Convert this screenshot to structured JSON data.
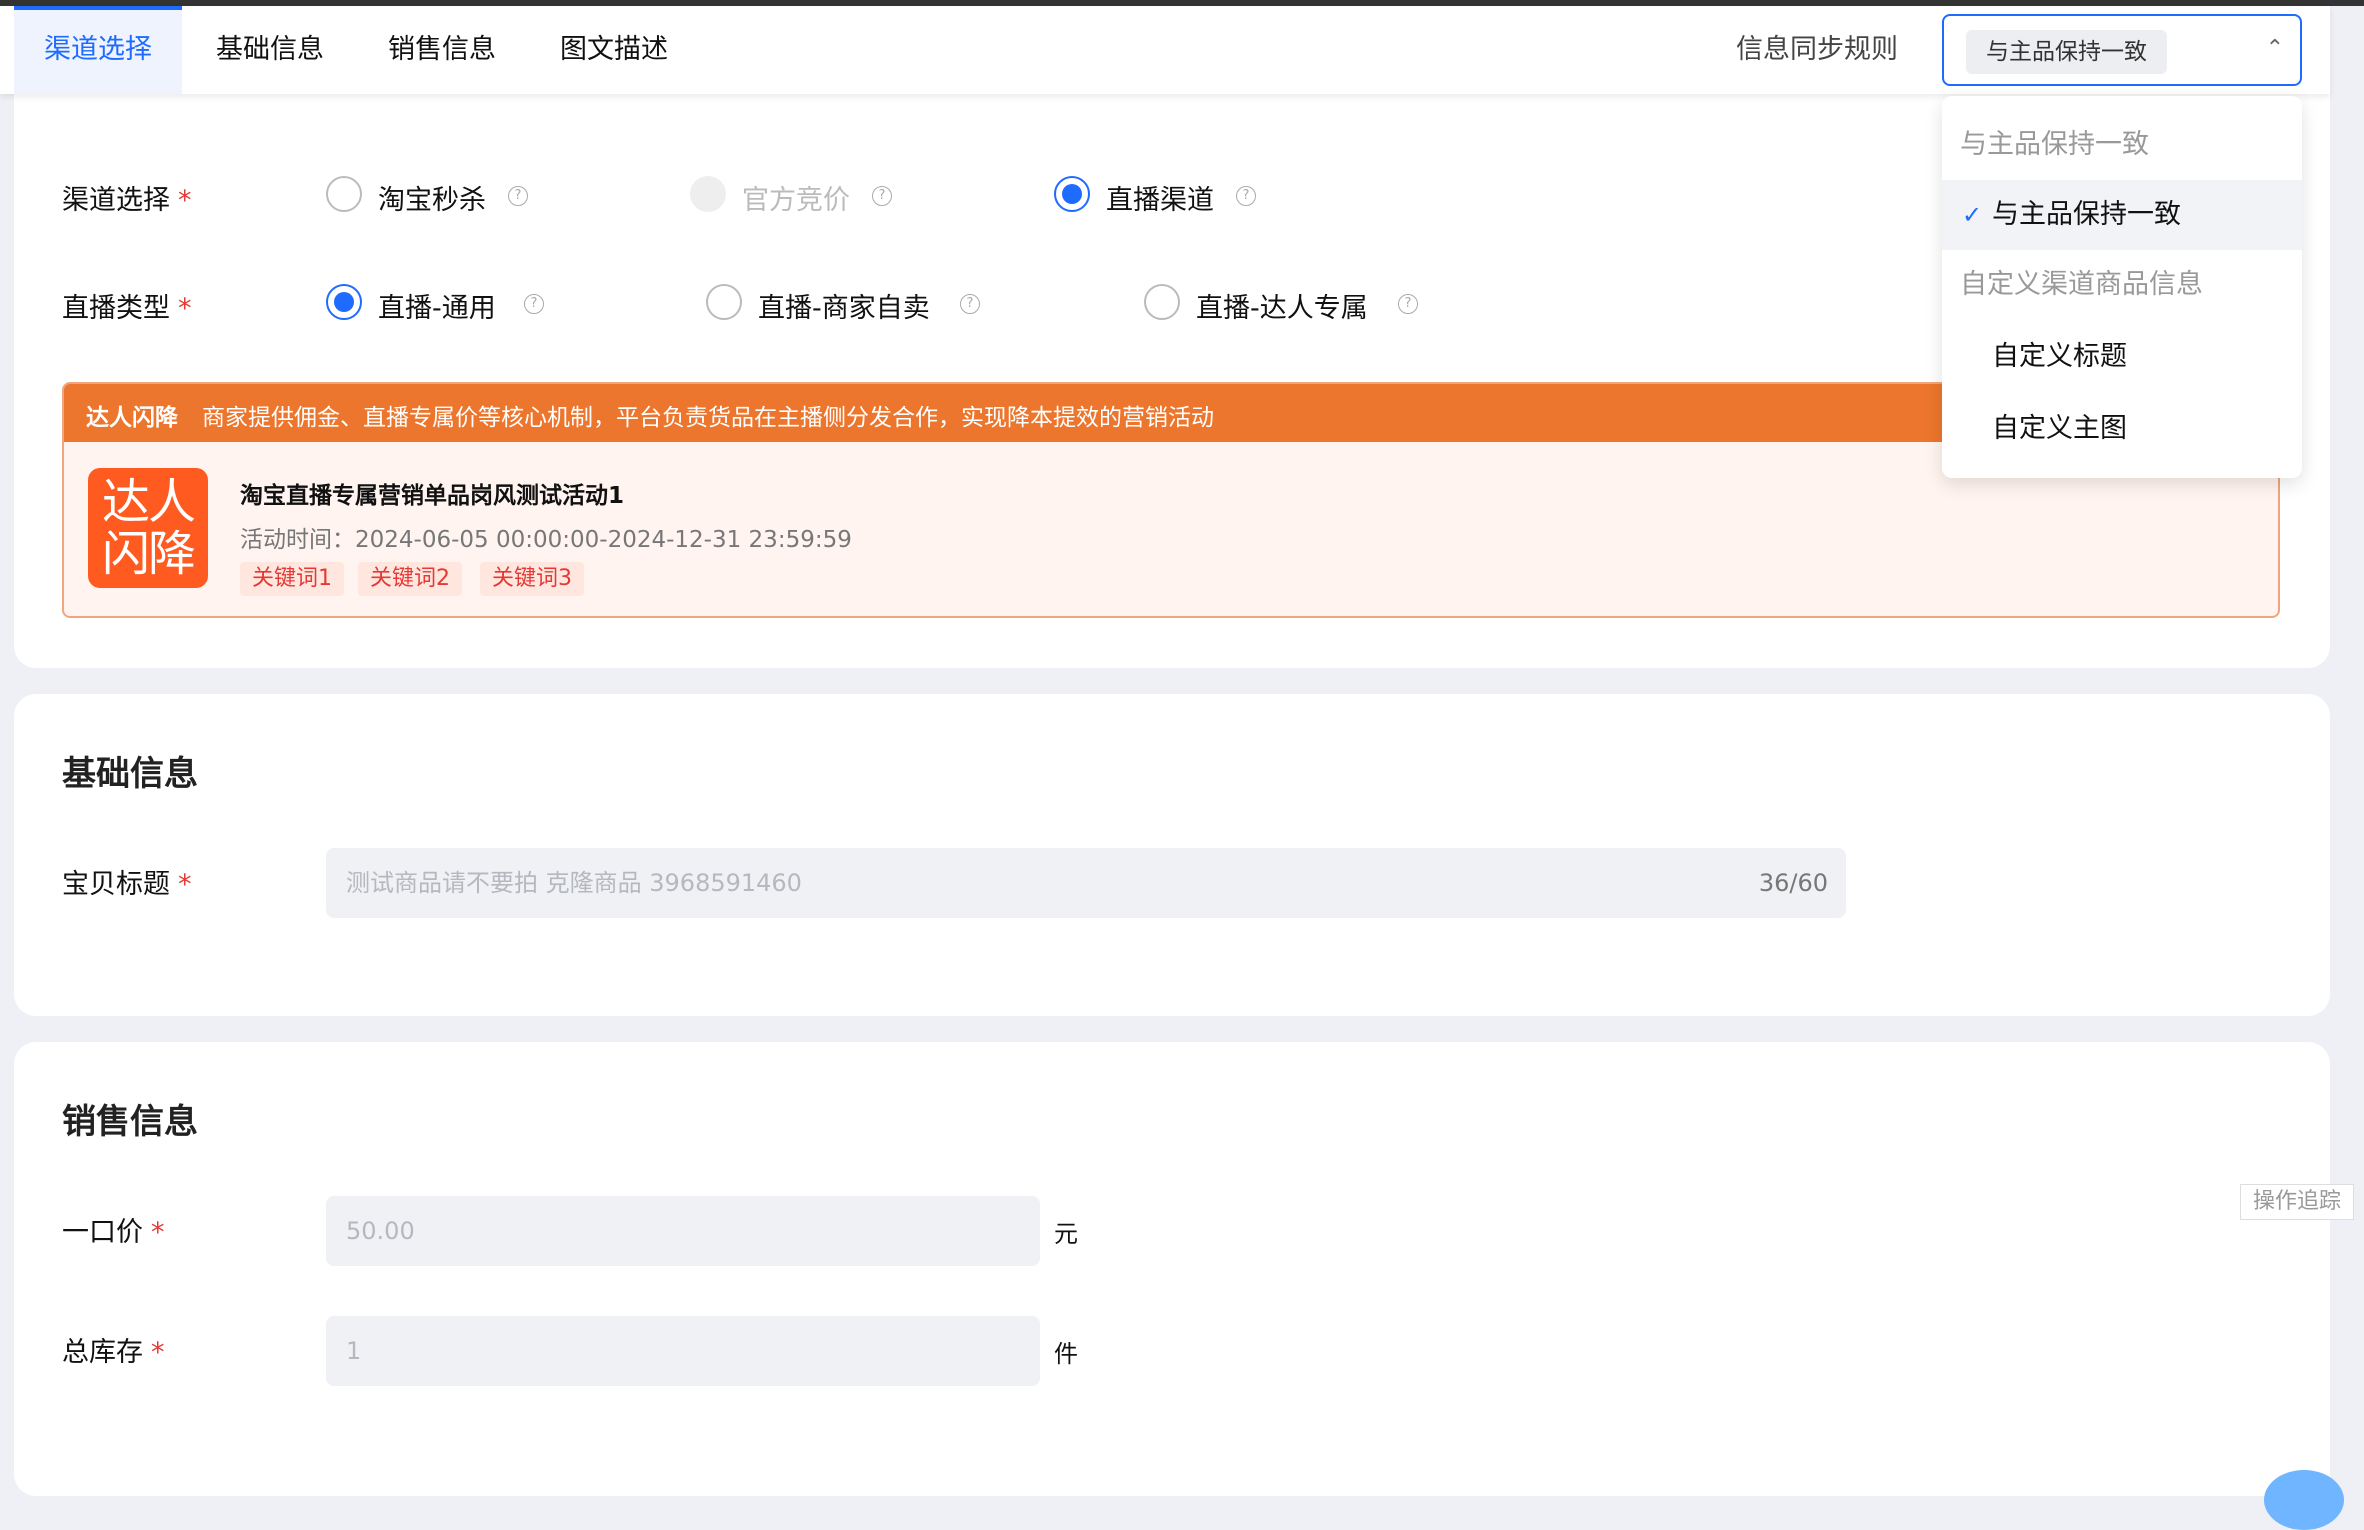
{
  "tabs": [
    {
      "label": "渠道选择",
      "active": true
    },
    {
      "label": "基础信息",
      "active": false
    },
    {
      "label": "销售信息",
      "active": false
    },
    {
      "label": "图文描述",
      "active": false
    }
  ],
  "sync": {
    "label": "信息同步规则",
    "selected": "与主品保持一致",
    "dropdown": {
      "group1": "与主品保持一致",
      "item1": "与主品保持一致",
      "group2": "自定义渠道商品信息",
      "item2": "自定义标题",
      "item3": "自定义主图"
    }
  },
  "channel": {
    "label": "渠道选择",
    "required": "*",
    "options": [
      "淘宝秒杀",
      "官方竞价",
      "直播渠道"
    ]
  },
  "live_type": {
    "label": "直播类型",
    "required": "*",
    "options": [
      "直播-通用",
      "直播-商家自卖",
      "直播-达人专属"
    ]
  },
  "promo": {
    "title": "达人闪降",
    "desc": "商家提供佣金、直播专属价等核心机制，平台负责货品在主播侧分发合作，实现降本提效的营销活动",
    "logo_line1": "达人",
    "logo_line2": "闪降",
    "name": "淘宝直播专属营销单品岗风测试活动1",
    "time": "活动时间：2024-06-05 00:00:00-2024-12-31 23:59:59",
    "keywords": [
      "关键词1",
      "关键词2",
      "关键词3"
    ]
  },
  "basic": {
    "title": "基础信息",
    "item_title_label": "宝贝标题",
    "required": "*",
    "item_title_value": "测试商品请不要拍 克隆商品 3968591460",
    "item_title_count": "36/60"
  },
  "sales": {
    "title": "销售信息",
    "price_label": "一口价",
    "price_value": "50.00",
    "price_unit": "元",
    "stock_label": "总库存",
    "stock_value": "1",
    "stock_unit": "件",
    "required": "*"
  },
  "trace_button": "操作追踪",
  "help_glyph": "?",
  "check_glyph": "✓",
  "chevron_glyph": "⌃"
}
